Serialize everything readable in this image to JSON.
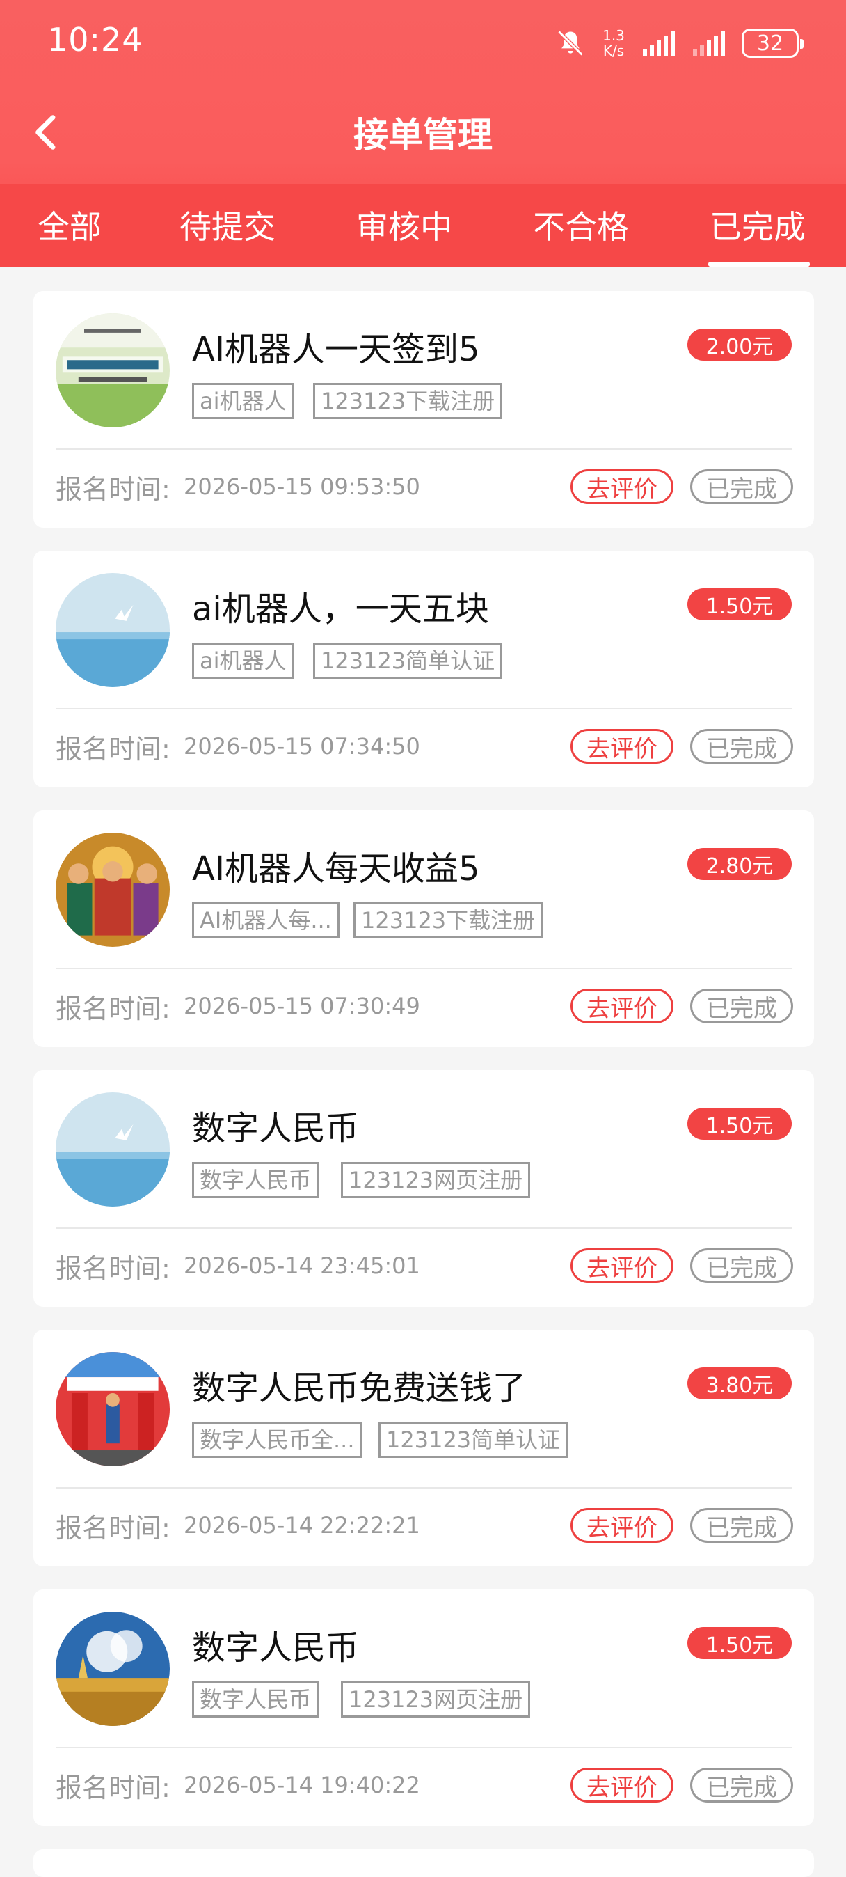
{
  "status_bar": {
    "time": "10:24",
    "net_speed_value": "1.3",
    "net_speed_unit": "K/s",
    "battery": "32"
  },
  "header": {
    "title": "接单管理",
    "back_icon": "chevron-left-icon"
  },
  "tabs": [
    {
      "label": "全部",
      "active": false
    },
    {
      "label": "待提交",
      "active": false
    },
    {
      "label": "审核中",
      "active": false
    },
    {
      "label": "不合格",
      "active": false
    },
    {
      "label": "已完成",
      "active": true
    }
  ],
  "labels": {
    "signup_time": "报名时间:",
    "review_button": "去评价",
    "status_done": "已完成"
  },
  "orders": [
    {
      "title": "AI机器人一天签到5",
      "price": "2.00元",
      "tags": [
        "ai机器人",
        "123123下载注册"
      ],
      "time": "2026-05-15 09:53:50",
      "avatar": "motivational-poster"
    },
    {
      "title": "ai机器人，一天五块",
      "price": "1.50元",
      "tags": [
        "ai机器人",
        "123123简单认证"
      ],
      "time": "2026-05-15 07:34:50",
      "avatar": "seagull-sea"
    },
    {
      "title": "AI机器人每天收益5",
      "price": "2.80元",
      "tags": [
        "AI机器人每...",
        "123123下载注册"
      ],
      "time": "2026-05-15 07:30:49",
      "avatar": "wealth-gods"
    },
    {
      "title": "数字人民币",
      "price": "1.50元",
      "tags": [
        "数字人民币",
        "123123网页注册"
      ],
      "time": "2026-05-14 23:45:01",
      "avatar": "seagull-sea"
    },
    {
      "title": "数字人民币免费送钱了",
      "price": "3.80元",
      "tags": [
        "数字人民币全...",
        "123123简单认证"
      ],
      "time": "2026-05-14 22:22:21",
      "avatar": "race-finish"
    },
    {
      "title": "数字人民币",
      "price": "1.50元",
      "tags": [
        "数字人民币",
        "123123网页注册"
      ],
      "time": "2026-05-14 19:40:22",
      "avatar": "wheat-field-painting"
    }
  ],
  "colors": {
    "primary_red": "#f24444",
    "header_red": "#f96060",
    "muted_gray": "#999999"
  }
}
